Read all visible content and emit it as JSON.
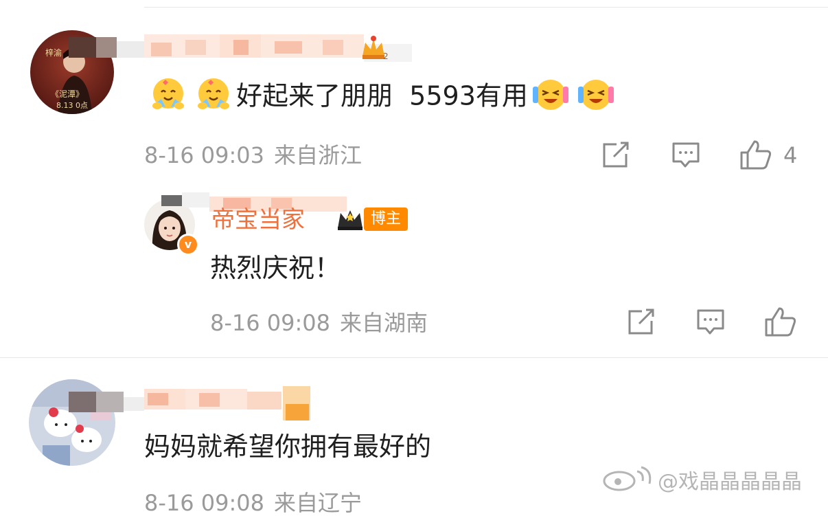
{
  "comments": [
    {
      "text": "好起来了朋朋  5593有用",
      "time": "8-16 09:03",
      "location": "来自浙江",
      "likes": "4",
      "avatar_text_top": "梓渝",
      "avatar_text_mid": "《泥潭》",
      "avatar_text_bottom": "8.13 0点"
    },
    {
      "reply": true,
      "name": "帝宝当家",
      "tag": "博主",
      "verified_mark": "v",
      "text": "热烈庆祝！",
      "time": "8-16 09:08",
      "location": "来自湖南"
    },
    {
      "text": "妈妈就希望你拥有最好的",
      "time": "8-16 09:08",
      "location": "来自辽宁"
    }
  ],
  "watermark": "@戏晶晶晶晶晶",
  "colors": {
    "accent": "#ff8a00",
    "meta_text": "#9a9a9a",
    "separator": "#e6e6e6"
  },
  "icons": [
    "share-icon",
    "comment-icon",
    "like-icon",
    "hug-emoji-icon",
    "laugh-cry-emoji-icon",
    "crown-badge-icon",
    "weibo-logo-icon"
  ]
}
